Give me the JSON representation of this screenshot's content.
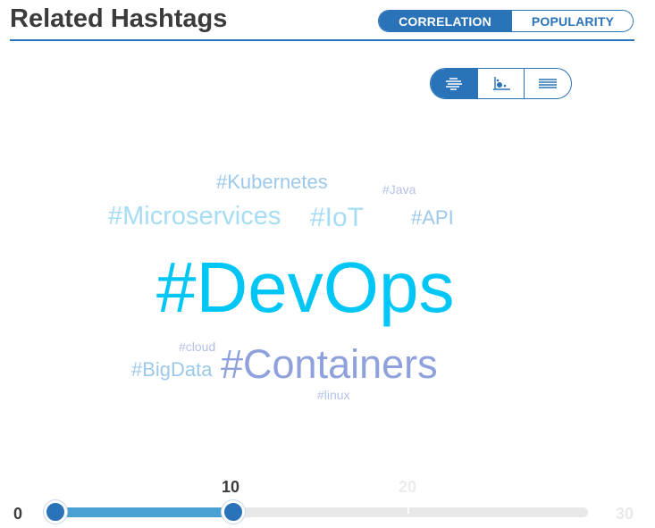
{
  "header": {
    "title": "Related Hashtags",
    "toggle": [
      {
        "label": "CORRELATION",
        "active": true
      },
      {
        "label": "POPULARITY",
        "active": false
      }
    ]
  },
  "view_modes": [
    {
      "icon": "cloud-view-icon",
      "active": true
    },
    {
      "icon": "scatter-view-icon",
      "active": false
    },
    {
      "icon": "list-view-icon",
      "active": false
    }
  ],
  "cloud": {
    "tags": [
      {
        "text": "#Kubernetes",
        "color": "#9cc9ea"
      },
      {
        "text": "#Java",
        "color": "#b4c1e6"
      },
      {
        "text": "#Microservices",
        "color": "#a6dcf4"
      },
      {
        "text": "#IoT",
        "color": "#a6dcf4"
      },
      {
        "text": "#API",
        "color": "#9cc9ea"
      },
      {
        "text": "#DevOps",
        "color": "#00c6f5"
      },
      {
        "text": "#cloud",
        "color": "#b4c1e6"
      },
      {
        "text": "#BigData",
        "color": "#9cc9ea"
      },
      {
        "text": "#Containers",
        "color": "#8fa1dd"
      },
      {
        "text": "#linux",
        "color": "#b4c1e6"
      }
    ]
  },
  "slider": {
    "min_label": "0",
    "max_label": "30",
    "value_label": "10",
    "next_label": "20",
    "min": 0,
    "max": 30,
    "low": 0,
    "high": 10
  },
  "colors": {
    "accent": "#2a73b8",
    "fill": "#4aa0d2",
    "track": "#e8e8e8"
  }
}
